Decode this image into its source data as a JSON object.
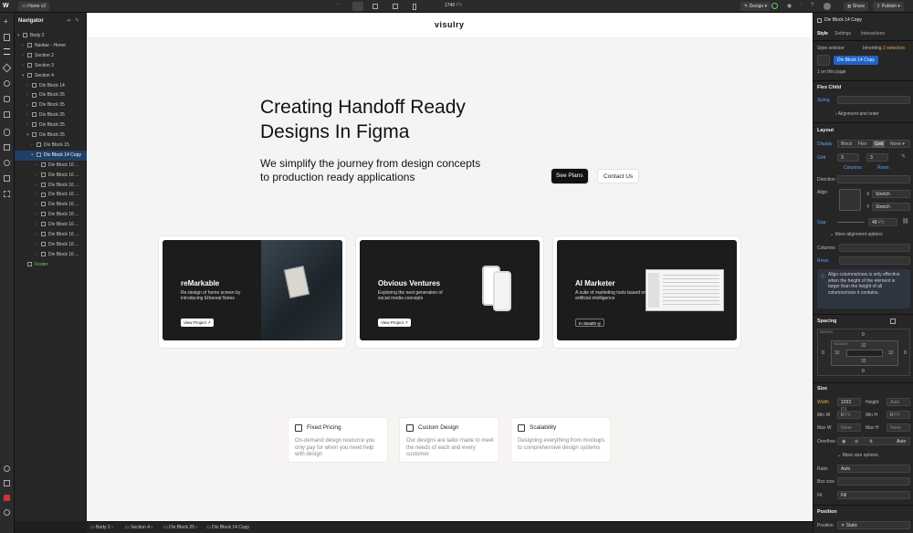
{
  "topbar": {
    "page_tab": "Home v2",
    "width_value": "1746",
    "width_unit": "PX",
    "design_label": "Design",
    "share_label": "Share",
    "publish_label": "Publish"
  },
  "navigator": {
    "title": "Navigator",
    "items": [
      {
        "label": "Body 2",
        "depth": 0,
        "caret": "▾"
      },
      {
        "label": "Navbar - Home",
        "depth": 1,
        "caret": "›"
      },
      {
        "label": "Section 2",
        "depth": 1,
        "caret": "›"
      },
      {
        "label": "Section 3",
        "depth": 1,
        "caret": "›"
      },
      {
        "label": "Section 4",
        "depth": 1,
        "caret": "▾"
      },
      {
        "label": "Div Block 14",
        "depth": 2,
        "caret": "›"
      },
      {
        "label": "Div Block 25",
        "depth": 2,
        "caret": "›"
      },
      {
        "label": "Div Block 35",
        "depth": 2,
        "caret": "›"
      },
      {
        "label": "Div Block 25",
        "depth": 2,
        "caret": "›"
      },
      {
        "label": "Div Block 25",
        "depth": 2,
        "caret": "›"
      },
      {
        "label": "Div Block 25",
        "depth": 2,
        "caret": "▾"
      },
      {
        "label": "Div Block 15",
        "depth": 3,
        "caret": "›"
      },
      {
        "label": "Div Block 14 Copy",
        "depth": 3,
        "caret": "▾",
        "selected": true
      },
      {
        "label": "Div Block 16 ...",
        "depth": 4,
        "caret": "›"
      },
      {
        "label": "Div Block 16 ...",
        "depth": 4,
        "caret": "›"
      },
      {
        "label": "Div Block 16 ...",
        "depth": 4,
        "caret": "›"
      },
      {
        "label": "Div Block 16 ...",
        "depth": 4,
        "caret": "›"
      },
      {
        "label": "Div Block 16 ...",
        "depth": 4,
        "caret": "›"
      },
      {
        "label": "Div Block 16 ...",
        "depth": 4,
        "caret": "›"
      },
      {
        "label": "Div Block 16 ...",
        "depth": 4,
        "caret": "›"
      },
      {
        "label": "Div Block 16 ...",
        "depth": 4,
        "caret": "›"
      },
      {
        "label": "Div Block 16 ...",
        "depth": 4,
        "caret": "›"
      },
      {
        "label": "Div Block 16 ...",
        "depth": 4,
        "caret": "›"
      },
      {
        "label": "Footer",
        "depth": 1,
        "caret": "",
        "green": true
      }
    ]
  },
  "canvas": {
    "logo": "visulry",
    "hero_title_1": "Creating Handoff Ready",
    "hero_title_2": "Designs In Figma",
    "hero_sub_1": "We simplify the journey from design concepts",
    "hero_sub_2": "to production ready applications",
    "btn_plans": "See Plans",
    "btn_contact": "Contact Us",
    "cards": [
      {
        "title": "reMarkable",
        "desc": "Re-design of home screen by introducing Ethereal Notes",
        "btn": "View Project ↗"
      },
      {
        "title": "Obvious Ventures",
        "desc": "Exploring the next generation of social media concepts",
        "btn": "View Project ↗"
      },
      {
        "title": "AI Marketer",
        "desc": "A suite of marketing tools based on artificial intelligence",
        "btn": "In Stealth ◎"
      }
    ],
    "features": [
      {
        "title": "Fixed Pricing",
        "desc": "On-demand design resource you only pay for when you need help with design"
      },
      {
        "title": "Custom Design",
        "desc": "Our designs are tailor made to meet the needs of each and every customer"
      },
      {
        "title": "Scalability",
        "desc": "Designing everything from mockups to comprehensive design systems"
      }
    ]
  },
  "bottombar": {
    "crumbs": [
      "Body 2",
      "Section 4",
      "Div Block 25",
      "Div Block 14 Copy"
    ]
  },
  "right": {
    "element_name": "Div Block 14 Copy",
    "tabs": [
      "Style",
      "Settings",
      "Interactions"
    ],
    "style_selector": "Style selector",
    "inheriting_prefix": "Inheriting",
    "inheriting_count": "2 selectors",
    "selector_chip": "Div Block 14 Copy",
    "on_page": "1 on this page",
    "flex_child": "Flex Child",
    "sizing": "Sizing",
    "alignment_order": "Alignment and order",
    "layout": "Layout",
    "display": "Display",
    "display_opts": [
      "Block",
      "Flex",
      "Grid",
      "None ▾"
    ],
    "grid": "Grid",
    "grid_cols": "3",
    "grid_rows": "3",
    "columns": "Columns",
    "rows": "Rows",
    "direction": "Direction",
    "align": "Align",
    "x_label": "X",
    "y_label": "Y",
    "stretch_x": "Stretch",
    "stretch_y": "Stretch",
    "gap": "Gap",
    "gap_value": "48",
    "gap_unit": "PX",
    "more_align": "More alignment options",
    "columns2": "Columns",
    "rows2": "Rows",
    "info": "Align columns/rows is only effective when the height of the element is larger than the height of all columns/rows it contains.",
    "spacing": "Spacing",
    "margin_label": "MARGIN",
    "padding_label": "PADDING",
    "margin_top": "0",
    "margin_bottom": "0",
    "margin_left": "0",
    "margin_right": "0",
    "pad_top": "32",
    "pad_bottom": "32",
    "pad_left": "32",
    "pad_right": "32",
    "size": "Size",
    "width_label": "Width",
    "width_value": "1033",
    "width_unit": "PX",
    "height_label": "Height",
    "height_value": "Auto",
    "minw_label": "Min W",
    "minw_value": "0",
    "minw_unit": "PX",
    "minh_label": "Min H",
    "minh_value": "0",
    "minh_unit": "PX",
    "maxw_label": "Max W",
    "maxw_value": "None",
    "maxh_label": "Max H",
    "maxh_value": "None",
    "overflow": "Overflow",
    "overflow_auto": "Auto",
    "more_size": "More size options",
    "ratio": "Ratio",
    "ratio_value": "Auto",
    "boxsize": "Box size",
    "fit": "Fit",
    "fit_value": "Fill",
    "position": "Position",
    "position_label": "Position",
    "position_value": "Static"
  }
}
